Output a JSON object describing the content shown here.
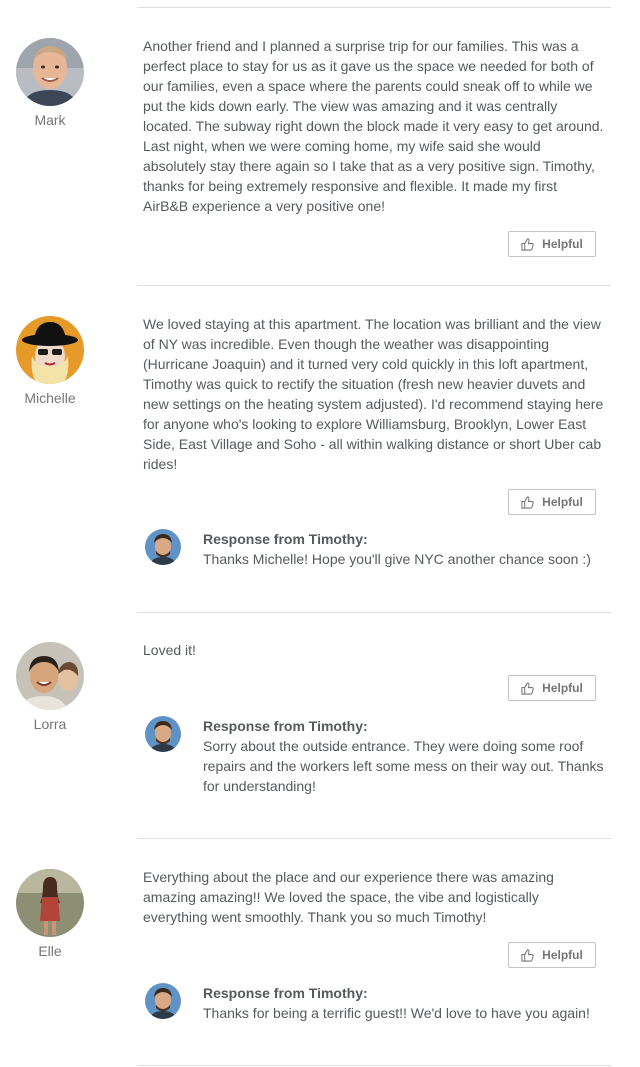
{
  "reviews": [
    {
      "name": "Mark",
      "avatar_icon": "user-photo-mark",
      "text": "Another friend and I planned a surprise trip for our families. This was a perfect place to stay for us as it gave us the space we needed for both of our families, even a space where the parents could sneak off to while we put the kids down early. The view was amazing and it was centrally located. The subway right down the block made it very easy to get around. Last night, when we were coming home, my wife said she would absolutely stay there again so I take that as a very positive sign. Timothy, thanks for being extremely responsive and flexible. It made my first AirB&B experience a very positive one!",
      "helpful_label": "Helpful"
    },
    {
      "name": "Michelle",
      "avatar_icon": "user-photo-michelle",
      "text": "We loved staying at this apartment. The location was brilliant and the view of NY was incredible. Even though the weather was disappointing (Hurricane Joaquin) and it turned very cold quickly in this loft apartment, Timothy was quick to rectify the situation (fresh new heavier duvets and new settings on the heating system adjusted). I'd recommend staying here for anyone who's looking to explore Williamsburg, Brooklyn, Lower East Side, East Village and Soho - all within walking distance or short Uber cab rides!",
      "helpful_label": "Helpful",
      "response": {
        "title": "Response from Timothy:",
        "text": "Thanks Michelle! Hope you'll give NYC another chance soon :)"
      }
    },
    {
      "name": "Lorra",
      "avatar_icon": "user-photo-lorra",
      "text": "Loved it!",
      "helpful_label": "Helpful",
      "response": {
        "title": "Response from Timothy:",
        "text": "Sorry about the outside entrance. They were doing some roof repairs and the workers left some mess on their way out. Thanks for understanding!"
      }
    },
    {
      "name": "Elle",
      "avatar_icon": "user-photo-elle",
      "text": "Everything about the place and our experience there was amazing amazing amazing!! We loved the space, the vibe and logistically everything went smoothly. Thank you so much Timothy!",
      "helpful_label": "Helpful",
      "response": {
        "title": "Response from Timothy:",
        "text": "Thanks for being a terrific guest!! We'd love to have you again!"
      }
    }
  ],
  "icons": {
    "helpful": "thumbs-up-icon",
    "host_avatar": "host-photo-timothy"
  },
  "colors": {
    "text": "#565a5c",
    "muted": "#767676",
    "divider": "#dce0e0",
    "button_border": "#c4c4c4"
  }
}
